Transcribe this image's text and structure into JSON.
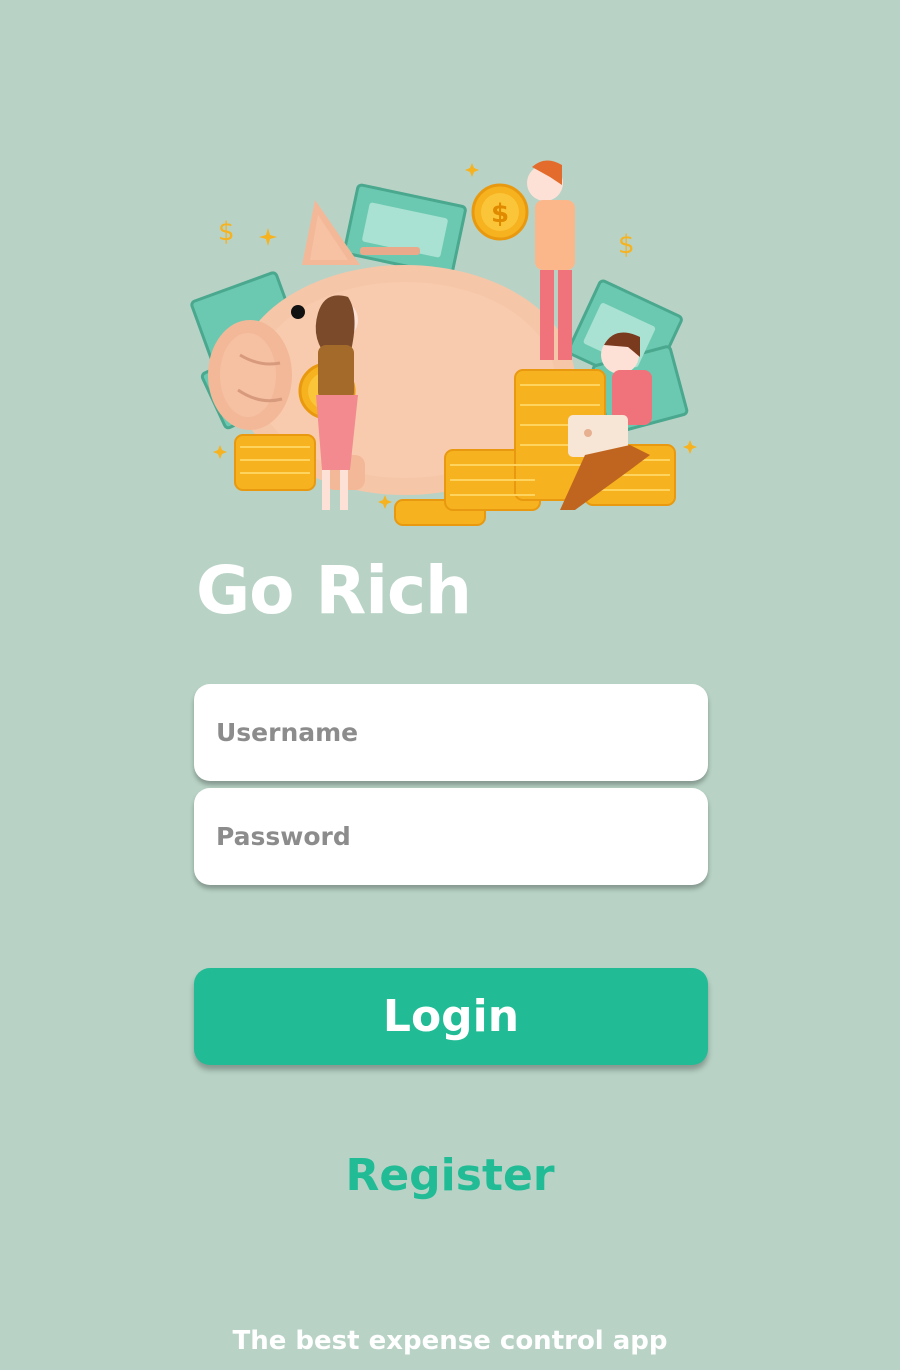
{
  "app": {
    "title": "Go Rich",
    "tagline": "The best expense control app"
  },
  "form": {
    "username_placeholder": "Username",
    "password_placeholder": "Password",
    "login_label": "Login",
    "register_label": "Register"
  },
  "colors": {
    "background": "#b8d3c6",
    "accent": "#21bc95",
    "field_bg": "#ffffff",
    "placeholder": "#8c8c8c"
  },
  "hero": {
    "icon": "piggy-bank-savings-illustration",
    "currency_symbol": "$"
  }
}
